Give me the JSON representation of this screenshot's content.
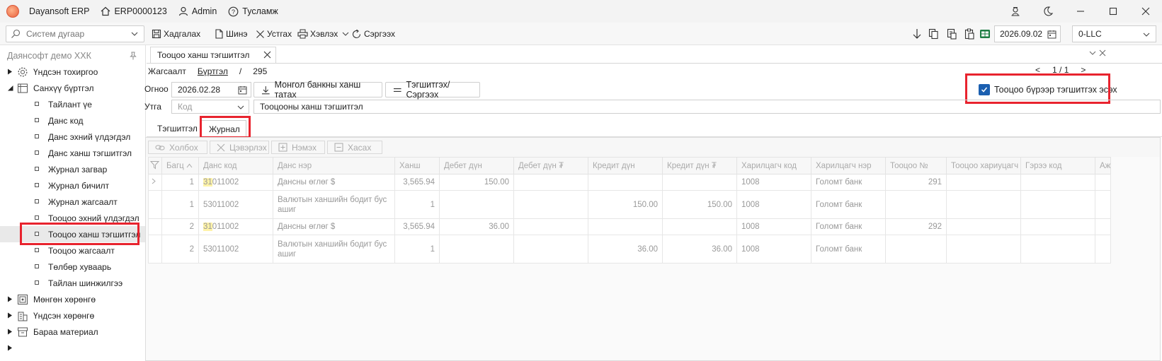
{
  "app": {
    "name": "Dayansoft ERP",
    "instance": "ERP0000123",
    "user": "Admin",
    "help": "Тусламж"
  },
  "toolbar": {
    "search_placeholder": "Систем дугаар",
    "save": "Хадгалах",
    "new": "Шинэ",
    "delete": "Устгах",
    "print": "Хэвлэх",
    "refresh": "Сэргээх",
    "date": "2026.09.02",
    "company": "0-LLC"
  },
  "sidebar": {
    "header": "Даянсофт демо ХХК",
    "groups": [
      {
        "label": "Үндсэн тохиргоо"
      },
      {
        "label": "Санхүү бүртгэл"
      },
      {
        "label": "Мөнгөн хөрөнгө"
      },
      {
        "label": "Үндсэн хөрөнгө"
      },
      {
        "label": "Бараа материал"
      }
    ],
    "items": [
      {
        "label": "Тайлант үе"
      },
      {
        "label": "Данс код"
      },
      {
        "label": "Данс эхний үлдэгдэл"
      },
      {
        "label": "Данс ханш тэгшитгэл"
      },
      {
        "label": "Журнал загвар"
      },
      {
        "label": "Журнал бичилт"
      },
      {
        "label": "Журнал жагсаалт"
      },
      {
        "label": "Тооцоо эхний үлдэгдэл"
      },
      {
        "label": "Тооцоо ханш тэгшитгэл"
      },
      {
        "label": "Тооцоо жагсаалт"
      },
      {
        "label": "Төлбөр хуваарь"
      },
      {
        "label": "Тайлан шинжилгээ"
      }
    ]
  },
  "document": {
    "tab_title": "Тооцоо ханш тэгшитгэл",
    "crumb_list": "Жагсаалт",
    "crumb_register": "Бүртгэл",
    "crumb_sep": "/",
    "record_no": "295",
    "pager_prev": "<",
    "pager_pos": "1 / 1",
    "pager_next": ">",
    "date_label": "Огноо",
    "date_value": "2026.02.28",
    "fetch_rate_btn": "Монгол банкны ханш татах",
    "rebalance_btn": "Тэгшитгэх/Сэргээх",
    "per_settlement_label": "Тооцоо бүрээр тэгшитгэх эсэх",
    "desc_label": "Утга",
    "code_placeholder": "Код",
    "desc_value": "Тооцооны ханш тэгшитгэл"
  },
  "subtabs": {
    "rebalance": "Тэгшитгэл",
    "journal": "Журнал"
  },
  "grid_toolbar": {
    "link": "Холбох",
    "clear": "Цэвэрлэх",
    "add": "Нэмэх",
    "remove": "Хасах"
  },
  "grid": {
    "columns": [
      "Багц",
      "Данс код",
      "Данс нэр",
      "Ханш",
      "Дебет дүн",
      "Дебет дүн ₮",
      "Кредит дүн",
      "Кредит дүн ₮",
      "Харилцагч код",
      "Харилцагч нэр",
      "Тооцоо №",
      "Тооцоо хариуцагч",
      "Гэрээ код",
      "Аж"
    ],
    "rows": [
      {
        "batch": "1",
        "code_hl": "31",
        "code_rest": "011002",
        "name": "Дансны өглөг $",
        "rate": "3,565.94",
        "debit": "150.00",
        "debit_mnt": "",
        "credit": "",
        "credit_mnt": "",
        "partner_code": "1008",
        "partner_name": "Голомт банк",
        "settlement_no": "291"
      },
      {
        "batch": "1",
        "code_hl": "",
        "code_rest": "53011002",
        "name": "Валютын ханшийн бодит бус ашиг",
        "rate": "1",
        "debit": "",
        "debit_mnt": "",
        "credit": "150.00",
        "credit_mnt": "150.00",
        "partner_code": "1008",
        "partner_name": "Голомт банк",
        "settlement_no": ""
      },
      {
        "batch": "2",
        "code_hl": "31",
        "code_rest": "011002",
        "name": "Дансны өглөг $",
        "rate": "3,565.94",
        "debit": "36.00",
        "debit_mnt": "",
        "credit": "",
        "credit_mnt": "",
        "partner_code": "1008",
        "partner_name": "Голомт банк",
        "settlement_no": "292"
      },
      {
        "batch": "2",
        "code_hl": "",
        "code_rest": "53011002",
        "name": "Валютын ханшийн бодит бус ашиг",
        "rate": "1",
        "debit": "",
        "debit_mnt": "",
        "credit": "36.00",
        "credit_mnt": "36.00",
        "partner_code": "1008",
        "partner_name": "Голомт банк",
        "settlement_no": ""
      }
    ]
  },
  "colors": {
    "highlight_frame": "#e8232e",
    "checkbox": "#1b5fb0",
    "search_match": "#fff3a8"
  }
}
